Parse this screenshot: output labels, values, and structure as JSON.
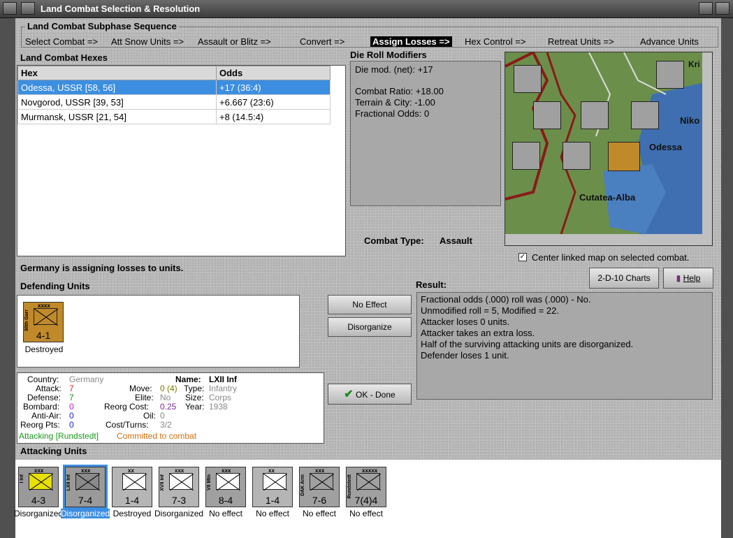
{
  "window": {
    "title": "Land Combat Selection & Resolution"
  },
  "phases": {
    "heading": "Land Combat Subphase Sequence",
    "items": [
      "Select Combat =>",
      "Att Snow Units =>",
      "Assault or Blitz =>",
      "Convert =>",
      "Assign Losses =>",
      "Hex Control =>",
      "Retreat Units =>",
      "Advance Units"
    ],
    "active_index": 4
  },
  "hexes": {
    "heading": "Land Combat Hexes",
    "columns": [
      "Hex",
      "Odds"
    ],
    "rows": [
      {
        "hex": "Odessa, USSR [58, 56]",
        "odds": "+17 (36:4)",
        "selected": true
      },
      {
        "hex": "Novgorod, USSR [39, 53]",
        "odds": "+6.667 (23:6)",
        "selected": false
      },
      {
        "hex": "Murmansk, USSR [21, 54]",
        "odds": "+8 (14.5:4)",
        "selected": false
      }
    ]
  },
  "modifiers": {
    "heading": "Die Roll Modifiers",
    "net": "Die mod. (net): +17",
    "combat_ratio": "Combat Ratio: +18.00",
    "terrain": "Terrain & City: -1.00",
    "fractional": "Fractional Odds: 0"
  },
  "combat_type": {
    "label": "Combat Type:",
    "value": "Assault"
  },
  "map": {
    "labels": [
      "Odessa",
      "Cutatea-Alba",
      "Niko",
      "Kri"
    ],
    "center_checkbox": "Center linked map on selected combat.",
    "center_checked": true
  },
  "assign_message": "Germany is assigning losses to units.",
  "defending": {
    "heading": "Defending Units",
    "units": [
      {
        "type": "xxxx",
        "name": "30th Garr",
        "strength": "4-1",
        "status": "Destroyed",
        "color": "#c08a2a"
      }
    ]
  },
  "buttons": {
    "no_effect": "No Effect",
    "disorganize": "Disorganize",
    "ok_done": "OK - Done",
    "charts": "2-D-10 Charts",
    "help": "Help"
  },
  "result": {
    "heading": "Result:",
    "lines": [
      "Fractional odds (.000) roll was (.000)  - No.",
      "Unmodified roll = 5, Modified = 22.",
      "Attacker loses 0 units.",
      "Attacker takes an extra loss.",
      "Half of the surviving attacking units are disorganized.",
      "Defender loses 1 unit."
    ]
  },
  "unit_info": {
    "country_label": "Country:",
    "country": "Germany",
    "attack_label": "Attack:",
    "attack": "7",
    "defense_label": "Defense:",
    "defense": "7",
    "bombard_label": "Bombard:",
    "bombard": "0",
    "antiair_label": "Anti-Air:",
    "antiair": "0",
    "reorg_label": "Reorg Pts:",
    "reorg": "0",
    "move_label": "Move:",
    "move": "0 (4)",
    "elite_label": "Elite:",
    "elite": "No",
    "reorg_cost_label": "Reorg Cost:",
    "reorg_cost": "0.25",
    "oil_label": "Oil:",
    "oil": "0",
    "cost_label": "Cost/Turns:",
    "cost": "3/2",
    "name_label": "Name:",
    "name": "LXII Inf",
    "type_label": "Type:",
    "type": "Infantry",
    "size_label": "Size:",
    "size": "Corps",
    "year_label": "Year:",
    "year": "1938",
    "attacking_text": "Attacking [Rundstedt]",
    "committed_text": "Committed to combat"
  },
  "attacking": {
    "heading": "Attacking Units",
    "units": [
      {
        "sz": "xxx",
        "name": "I Inf",
        "strength": "4-3",
        "status": "Disorganized",
        "color": "#9a9a9a",
        "nat": "#e8e000",
        "selected": false
      },
      {
        "sz": "xxx",
        "name": "LXII Inf",
        "strength": "7-4",
        "status": "Disorganized",
        "color": "#9a9a9a",
        "nat": "#8a8a8a",
        "selected": true
      },
      {
        "sz": "xx",
        "name": "",
        "strength": "1-4",
        "status": "Destroyed",
        "color": "#b5b5b5",
        "nat": "#ffffff",
        "selected": false
      },
      {
        "sz": "xxx",
        "name": "XVII Inf",
        "strength": "7-3",
        "status": "Disorganized",
        "color": "#b5b5b5",
        "nat": "#ffffff",
        "selected": false
      },
      {
        "sz": "xxx",
        "name": "VII Mtn",
        "strength": "8-4",
        "status": "No effect",
        "color": "#a0a0a0",
        "nat": "#ffffff",
        "selected": false
      },
      {
        "sz": "xx",
        "name": "",
        "strength": "1-4",
        "status": "No effect",
        "color": "#b5b5b5",
        "nat": "#ffffff",
        "selected": false
      },
      {
        "sz": "xxx",
        "name": "DAK Arm",
        "strength": "7-6",
        "status": "No effect",
        "color": "#a0a0a0",
        "nat": "#a0a0a0",
        "selected": false
      },
      {
        "sz": "xxxxx",
        "name": "Rundstedt",
        "strength": "7(4)4",
        "status": "No effect",
        "color": "#a0a0a0",
        "nat": "#a0a0a0",
        "selected": false
      }
    ]
  }
}
